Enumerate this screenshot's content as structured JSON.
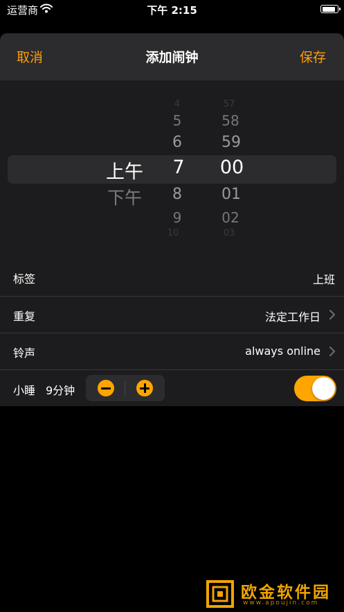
{
  "status_bar": {
    "carrier": "运营商",
    "time": "下午 2:15",
    "battery_level": 0.9
  },
  "nav": {
    "cancel": "取消",
    "title": "添加闹钟",
    "save": "保存"
  },
  "picker": {
    "ampm": {
      "selected": "上午",
      "below": [
        "下午"
      ]
    },
    "hour": {
      "above": [
        "4",
        "5",
        "6"
      ],
      "selected": "7",
      "below": [
        "8",
        "9",
        "10"
      ]
    },
    "minute": {
      "above": [
        "57",
        "58",
        "59"
      ],
      "selected": "00",
      "below": [
        "01",
        "02",
        "03"
      ]
    }
  },
  "settings": {
    "label": {
      "title": "标签",
      "value": "上班"
    },
    "repeat": {
      "title": "重复",
      "value": "法定工作日"
    },
    "sound": {
      "title": "铃声",
      "value": "always online"
    },
    "snooze": {
      "title": "小睡",
      "duration": "9分钟",
      "enabled": true
    }
  },
  "colors": {
    "accent": "#ff9f0a",
    "toggle_on": "#ffa500"
  },
  "watermark": {
    "name": "欧金软件园",
    "url": "www.apoujin.com"
  }
}
